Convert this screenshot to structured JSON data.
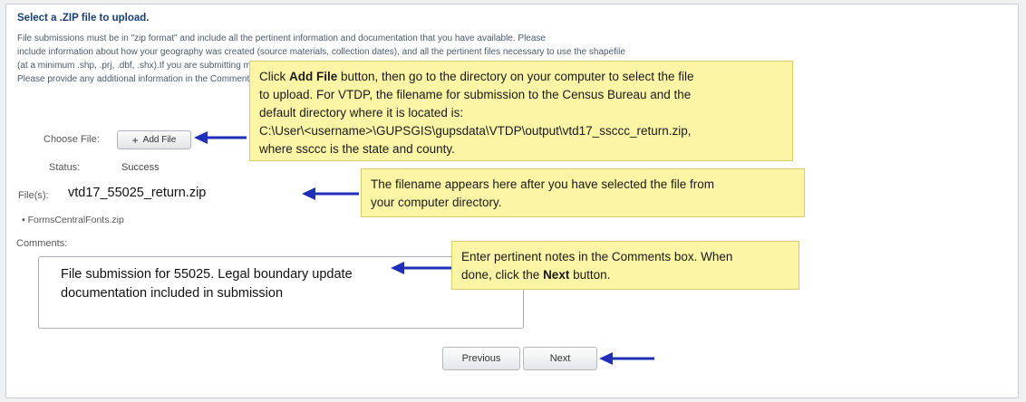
{
  "heading": "Select a .ZIP file to upload.",
  "instructions": {
    "line1": "File submissions must be in \"zip format\" and include all the pertinent information and documentation that you have available. Please",
    "line2": "include information about how your geography was created (source materials, collection dates), and all the pertinent files necessary to use the shapefile",
    "line3": "(at a minimum .shp, .prj, .dbf, .shx).If you are submitting multiple files, please combine them into one zip (all of the layers, shapefiles, etc.).",
    "line4": "Please provide any additional information in the Comments box below."
  },
  "upload": {
    "choose_label": "Choose File:",
    "add_button_icon": "+",
    "add_button_label": "Add File",
    "status_label": "Status:",
    "status_value": "Success",
    "files_label": "File(s):",
    "file_name": "vtd17_55025_return.zip",
    "file_items": [
      "• FormsCentralFonts.zip"
    ]
  },
  "comments": {
    "label": "Comments:",
    "line1": "File submission for 55025. Legal boundary update",
    "line2": "documentation included in submission"
  },
  "nav": {
    "previous": "Previous",
    "next": "Next"
  },
  "callouts": {
    "add_file": {
      "l1_pre": "Click ",
      "l1_bold": "Add File",
      "l1_post": " button, then go to the directory on your computer to select the file",
      "l2": "to upload. For VTDP, the filename for submission to the Census Bureau and the",
      "l3": "default directory where it is located is:",
      "l4": "C:\\User\\<username>\\GUPSGIS\\gupsdata\\VTDP\\output\\vtd17_ssccc_return.zip,",
      "l5": "where ssccc is the state and county."
    },
    "filename": {
      "l1": "The filename appears here after you have selected the file from",
      "l2": "your computer directory."
    },
    "comments": {
      "l1": "Enter pertinent notes in the Comments box. When",
      "l2_pre": "done, click the ",
      "l2_bold": "Next",
      "l2_post": " button."
    }
  },
  "colors": {
    "arrow": "#1f2fb8",
    "callout_bg": "#fcf5a6",
    "heading": "#1b3f74"
  }
}
